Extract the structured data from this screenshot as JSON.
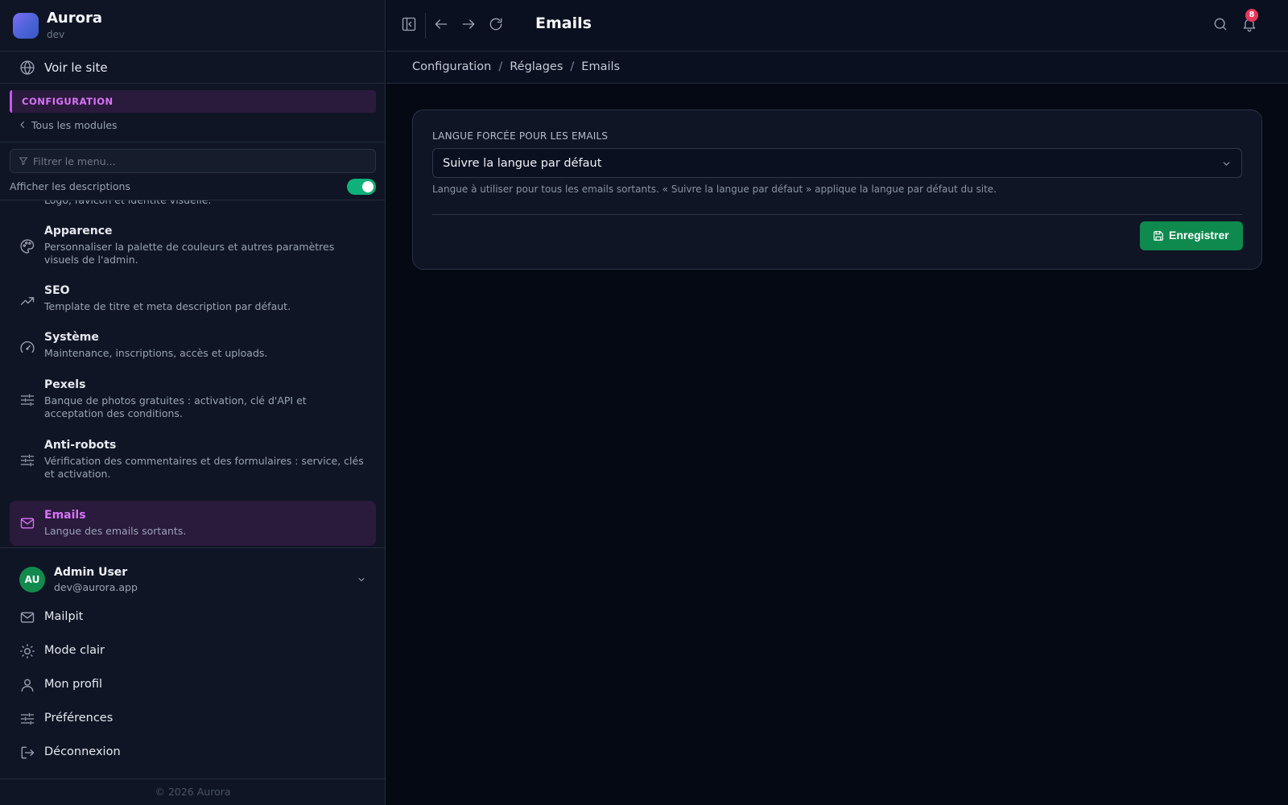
{
  "brand": {
    "name": "Aurora",
    "env": "dev"
  },
  "sidebar": {
    "view_site": "Voir le site",
    "section": "CONFIGURATION",
    "back": "Tous les modules",
    "filter_placeholder": "Filtrer le menu...",
    "show_descriptions": {
      "label": "Afficher les descriptions",
      "enabled": true
    },
    "items": [
      {
        "title": "",
        "desc": "Logo, favicon et identité visuelle.",
        "icon": "id-icon"
      },
      {
        "title": "Apparence",
        "desc": "Personnaliser la palette de couleurs et autres paramètres visuels de l'admin.",
        "icon": "palette-icon"
      },
      {
        "title": "SEO",
        "desc": "Template de titre et meta description par défaut.",
        "icon": "trending-up-icon"
      },
      {
        "title": "Système",
        "desc": "Maintenance, inscriptions, accès et uploads.",
        "icon": "gauge-icon"
      },
      {
        "title": "Pexels",
        "desc": "Banque de photos gratuites : activation, clé d'API et acceptation des conditions.",
        "icon": "sliders-icon"
      },
      {
        "title": "Anti-robots",
        "desc": "Vérification des commentaires et des formulaires : service, clés et activation.",
        "icon": "sliders-icon"
      },
      {
        "title": "Emails",
        "desc": "Langue des emails sortants.",
        "icon": "mail-icon",
        "active": true
      }
    ],
    "user": {
      "initials": "AU",
      "name": "Admin User",
      "email": "dev@aurora.app"
    },
    "bottom": [
      {
        "label": "Mailpit",
        "icon": "mail-icon"
      },
      {
        "label": "Mode clair",
        "icon": "sun-icon"
      },
      {
        "label": "Mon profil",
        "icon": "user-icon"
      },
      {
        "label": "Préférences",
        "icon": "sliders-icon"
      },
      {
        "label": "Déconnexion",
        "icon": "logout-icon"
      }
    ],
    "footer": "© 2026 Aurora"
  },
  "topbar": {
    "title": "Emails",
    "notifications": "8"
  },
  "breadcrumb": [
    "Configuration",
    "Réglages",
    "Emails"
  ],
  "form": {
    "label": "LANGUE FORCÉE POUR LES EMAILS",
    "value": "Suivre la langue par défaut",
    "help": "Langue à utiliser pour tous les emails sortants. « Suivre la langue par défaut » applique la langue par défaut du site.",
    "save": "Enregistrer"
  },
  "colors": {
    "accent": "#d774f7",
    "active_bg": "#2a1a3c",
    "success": "#0f8a4f",
    "badge": "#e8365d",
    "background": "#050914",
    "sidebar": "#0f1524"
  }
}
